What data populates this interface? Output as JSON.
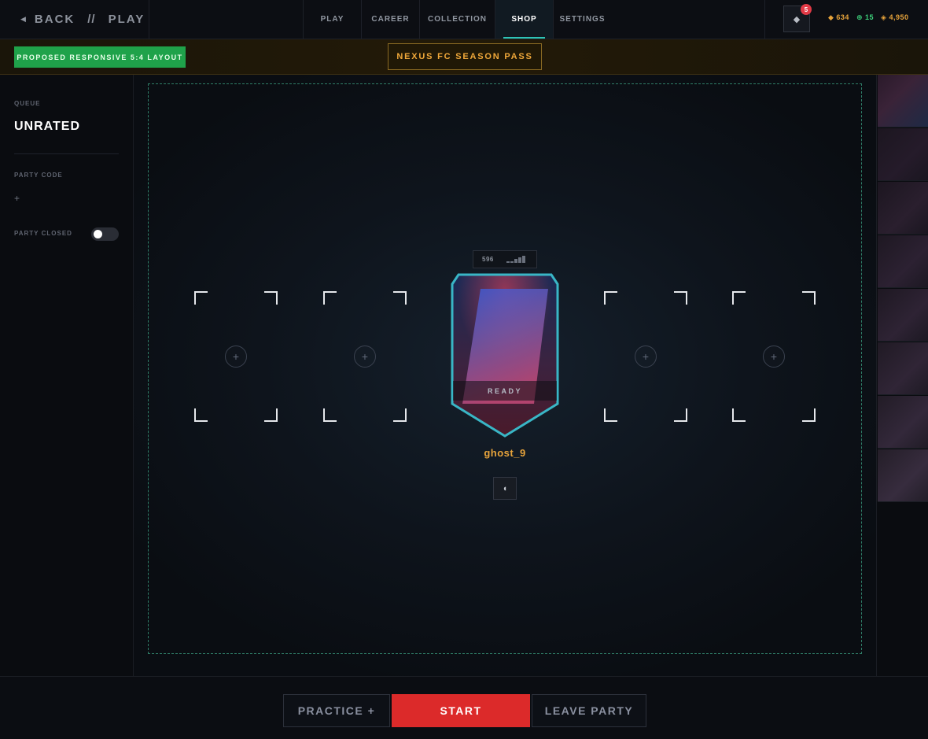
{
  "topbar": {
    "back_label": "BACK",
    "separator": "//",
    "context_label": "PLAY",
    "tabs": [
      {
        "label": "PLAY",
        "active": false
      },
      {
        "label": "CAREER",
        "active": false
      },
      {
        "label": "COLLECTION",
        "active": false
      },
      {
        "label": "SHOP",
        "active": true
      },
      {
        "label": "SETTINGS",
        "active": false
      }
    ],
    "notifications_count": "5",
    "currencies": [
      {
        "icon": "diamond-icon",
        "value": "634",
        "color": "#e8a43b"
      },
      {
        "icon": "radiant-icon",
        "value": "15",
        "color": "#3dd07a"
      },
      {
        "icon": "kingdom-icon",
        "value": "4,950",
        "color": "#e8a43b"
      }
    ]
  },
  "banner": {
    "proposed_label": "PROPOSED RESPONSIVE 5:4 LAYOUT",
    "season_pass_label": "NEXUS FC SEASON PASS"
  },
  "left_panel": {
    "queue_label": "QUEUE",
    "queue_value": "UNRATED",
    "party_code_label": "PARTY CODE",
    "party_code_value": "+",
    "party_closed_label": "PARTY CLOSED",
    "party_closed": false
  },
  "party": {
    "empty_slot_add": "+",
    "player": {
      "rank_value": "596",
      "status": "READY",
      "name": "ghost_9"
    }
  },
  "colors": {
    "accent_teal": "#2ec4b6",
    "gold": "#e8a43b",
    "start_red": "#dc2a2a",
    "proposed_green": "#1fa24a"
  },
  "actions": {
    "practice_label": "PRACTICE +",
    "start_label": "START",
    "leave_label": "LEAVE PARTY"
  }
}
